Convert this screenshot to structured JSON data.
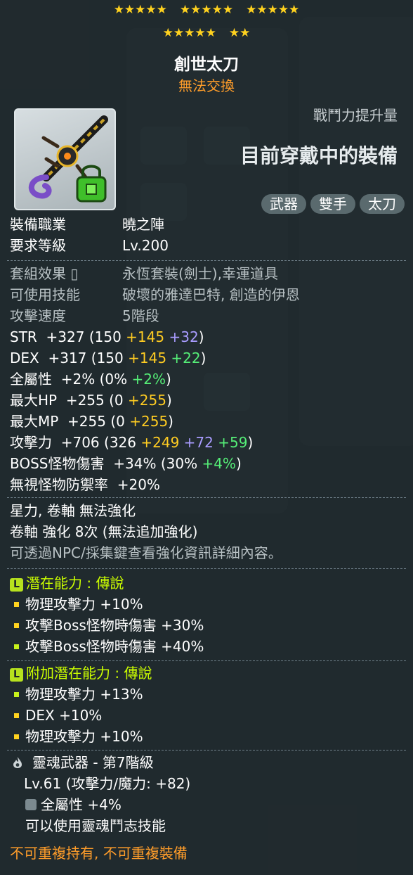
{
  "stars": {
    "row1": [
      "★★★★★",
      "★★★★★",
      "★★★★★"
    ],
    "row2": [
      "★★★★★",
      "★★"
    ]
  },
  "item": {
    "name": "創世太刀",
    "trade_status": "無法交換",
    "power_label": "戰鬥力提升量",
    "equipped_label": "目前穿戴中的裝備",
    "tags": [
      "武器",
      "雙手",
      "太刀"
    ]
  },
  "requirements": {
    "job_label": "裝備職業",
    "job": "曉之陣",
    "level_label": "要求等級",
    "level": "Lv.200"
  },
  "info": {
    "set_label": "套組效果",
    "set_value": "永恆套裝(劍士),幸運道具",
    "skill_label": "可使用技能",
    "skill_value": "破壞的雅達巴特, 創造的伊恩",
    "speed_label": "攻擊速度",
    "speed_value": "5階段"
  },
  "stats": {
    "str": {
      "label": "STR",
      "total": "+327",
      "base": "(150",
      "bonus1": "+145",
      "bonus2": "+32",
      "close": ")"
    },
    "dex": {
      "label": "DEX",
      "total": "+317",
      "base": "(150",
      "bonus1": "+145",
      "bonus2": "+22",
      "close": ")"
    },
    "all": {
      "label": "全屬性",
      "total": "+2%",
      "base": "(0%",
      "bonus": "+2%",
      "close": ")"
    },
    "hp": {
      "label": "最大HP",
      "total": "+255",
      "base": "(0",
      "bonus": "+255",
      "close": ")"
    },
    "mp": {
      "label": "最大MP",
      "total": "+255",
      "base": "(0",
      "bonus": "+255",
      "close": ")"
    },
    "atk": {
      "label": "攻擊力",
      "total": "+706",
      "base": "(326",
      "bonus1": "+249",
      "bonus2": "+72",
      "bonus3": "+59",
      "close": ")"
    },
    "boss": {
      "label": "BOSS怪物傷害",
      "total": "+34%",
      "base": "(30%",
      "bonus": "+4%",
      "close": ")"
    },
    "ignore": {
      "label": "無視怪物防禦率",
      "total": "+20%"
    }
  },
  "enhance": {
    "line1": "星力, 卷軸 無法強化",
    "line2": "卷軸 強化 8次 (無法追加強化)",
    "hint": "可透過NPC/採集鍵查看強化資訊詳細內容。"
  },
  "potential": {
    "icon": "L",
    "title": "潛在能力 : 傳說",
    "lines": [
      "物理攻擊力 +10%",
      "攻擊Boss怪物時傷害 +30%",
      "攻擊Boss怪物時傷害 +40%"
    ]
  },
  "additional": {
    "icon": "L",
    "title": "附加潛在能力 : 傳說",
    "lines": [
      "物理攻擊力 +13%",
      "DEX +10%",
      "物理攻擊力 +10%"
    ]
  },
  "soul": {
    "title": "靈魂武器 - 第7階級",
    "level": "Lv.61 (攻擊力/魔力: +82)",
    "stat": "全屬性 +4%",
    "skill": "可以使用靈魂鬥志技能"
  },
  "footer": "不可重複持有, 不可重複裝備",
  "colors": {
    "star": "#ffd21f",
    "orange": "#ff9d2a",
    "bonus_yellow": "#ffcc22",
    "bonus_purple": "#a99cff",
    "bonus_green": "#55ee77",
    "legend_lime": "#ccff00"
  }
}
